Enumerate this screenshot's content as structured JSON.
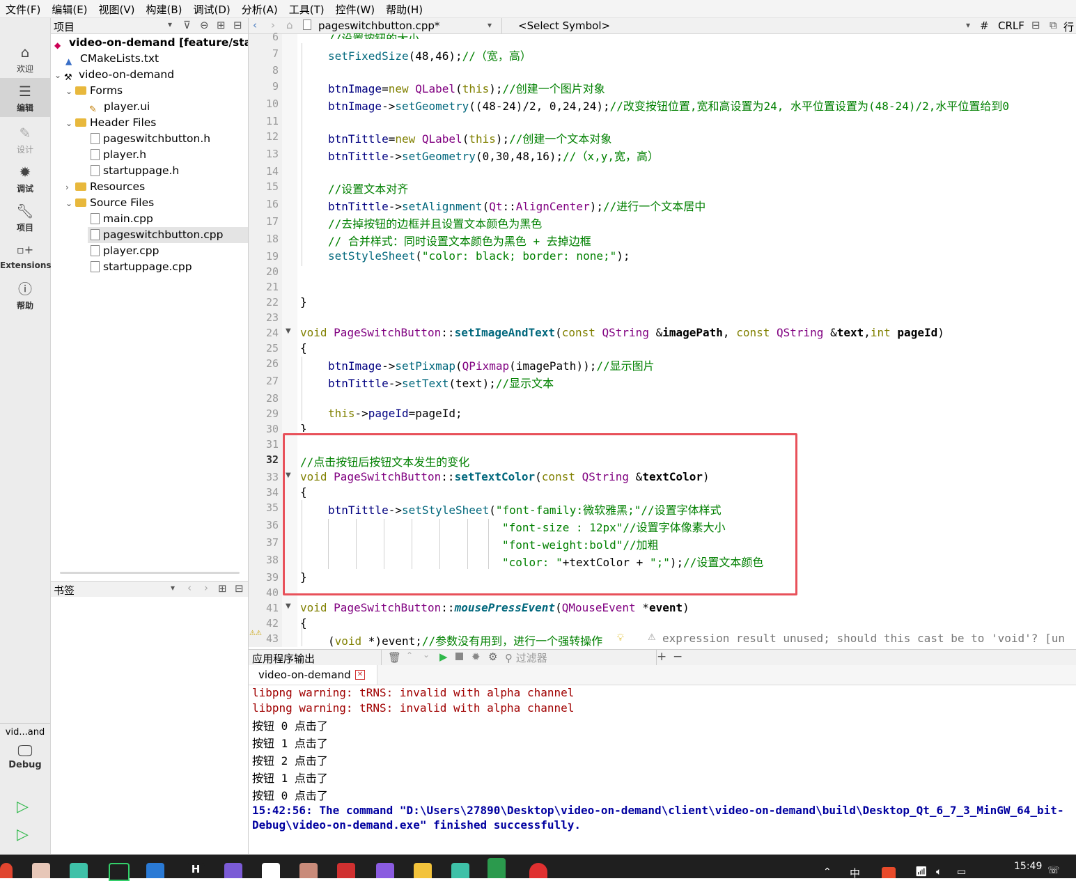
{
  "menu": [
    "文件(F)",
    "编辑(E)",
    "视图(V)",
    "构建(B)",
    "调试(D)",
    "分析(A)",
    "工具(T)",
    "控件(W)",
    "帮助(H)"
  ],
  "modes": [
    {
      "label": "欢迎",
      "icon": "home-icon"
    },
    {
      "label": "编辑",
      "icon": "edit-icon"
    },
    {
      "label": "设计",
      "icon": "design-icon"
    },
    {
      "label": "调试",
      "icon": "debug-icon"
    },
    {
      "label": "项目",
      "icon": "wrench-icon"
    },
    {
      "label": "Extensions",
      "icon": "extensions-icon"
    },
    {
      "label": "帮助",
      "icon": "help-icon"
    }
  ],
  "kit": {
    "project": "vid...and",
    "config": "Debug"
  },
  "project_pane": {
    "title": "项目",
    "root": "video-on-demand [feature/startui",
    "items": [
      "CMakeLists.txt",
      "video-on-demand",
      "Forms",
      "player.ui",
      "Header Files",
      "pageswitchbutton.h",
      "player.h",
      "startuppage.h",
      "Resources",
      "Source Files",
      "main.cpp",
      "pageswitchbutton.cpp",
      "player.cpp",
      "startuppage.cpp"
    ]
  },
  "bookmarks": {
    "title": "书签"
  },
  "editor": {
    "file": "pageswitchbutton.cpp*",
    "symbol": "<Select Symbol>",
    "hash": "#",
    "line_ending": "CRLF",
    "extra": "行",
    "warning": "expression result unused; should this cast be to 'void'? [un"
  },
  "output": {
    "title": "应用程序输出",
    "filter_placeholder": "过滤器",
    "tab": "video-on-demand",
    "lines": [
      "libpng warning: tRNS: invalid with alpha channel",
      "libpng warning: tRNS: invalid with alpha channel",
      "按钮 0 点击了",
      "按钮 1 点击了",
      "按钮 2 点击了",
      "按钮 1 点击了",
      "按钮 0 点击了",
      "15:42:56: The command \"D:\\Users\\27890\\Desktop\\video-on-demand\\client\\video-on-demand\\build\\Desktop_Qt_6_7_3_MinGW_64_bit-",
      "Debug\\video-on-demand.exe\" finished successfully."
    ]
  },
  "taskbar": {
    "time": "15:49",
    "ime": "中"
  }
}
